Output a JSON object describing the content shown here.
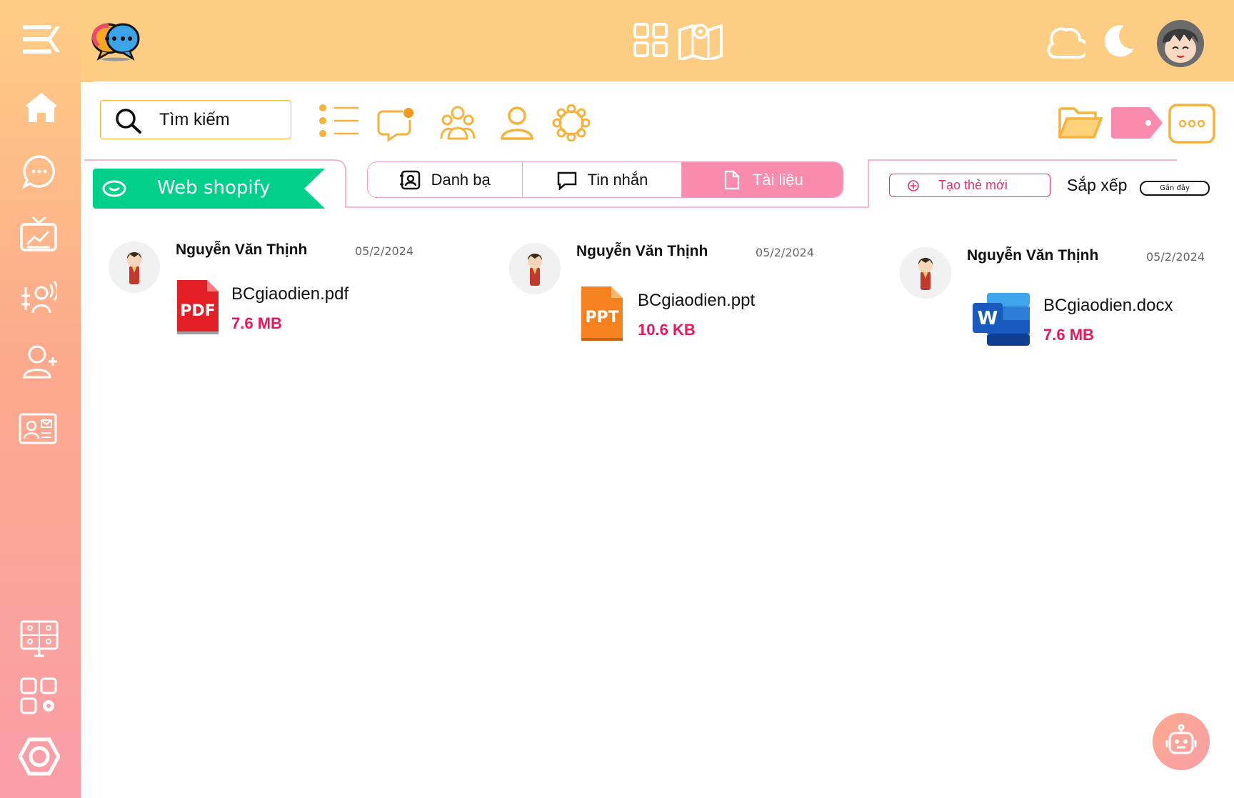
{
  "search": {
    "placeholder": "Tìm kiếm"
  },
  "group": {
    "name": "Web shopify"
  },
  "tabs": [
    {
      "label": "Danh bạ",
      "icon": "contacts-icon",
      "active": false
    },
    {
      "label": "Tin nhắn",
      "icon": "message-icon",
      "active": false
    },
    {
      "label": "Tài liệu",
      "icon": "document-icon",
      "active": true
    }
  ],
  "toolbar": {
    "new_tag_label": "Tạo thẻ mới",
    "sort_label": "Sắp xếp",
    "sort_value": "Gần đây"
  },
  "files": [
    {
      "sender": "Nguyễn Văn Thịnh",
      "date": "05/2/2024",
      "name": "BCgiaodien.pdf",
      "size": "7.6 MB",
      "type": "pdf",
      "type_label": "PDF"
    },
    {
      "sender": "Nguyễn Văn Thịnh",
      "date": "05/2/2024",
      "name": "BCgiaodien.ppt",
      "size": "10.6 KB",
      "type": "ppt",
      "type_label": "PPT"
    },
    {
      "sender": "Nguyễn Văn Thịnh",
      "date": "05/2/2024",
      "name": "BCgiaodien.docx",
      "size": "7.6 MB",
      "type": "docx",
      "type_label": "W"
    }
  ],
  "colors": {
    "topbar": "#FECD84",
    "accent_orange": "#F6B23A",
    "accent_pink": "#F98BAE",
    "accent_green": "#00D08A",
    "size_red": "#E8195A"
  }
}
